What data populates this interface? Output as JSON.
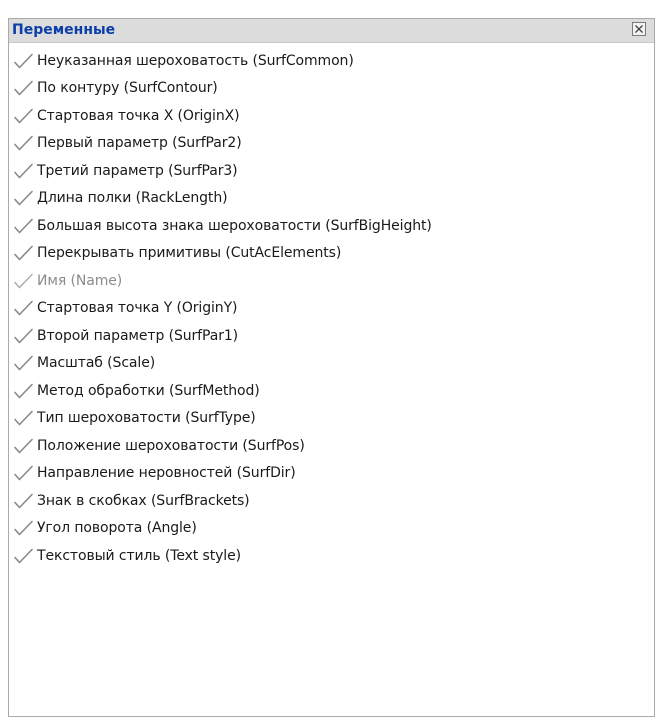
{
  "panel": {
    "title": "Переменные",
    "close_icon": "close-x-icon"
  },
  "items": [
    {
      "label": "Неуказанная шероховатость (SurfCommon)",
      "enabled": true
    },
    {
      "label": "По контуру (SurfContour)",
      "enabled": true
    },
    {
      "label": "Стартовая точка X (OriginX)",
      "enabled": true
    },
    {
      "label": "Первый параметр (SurfPar2)",
      "enabled": true
    },
    {
      "label": "Третий параметр (SurfPar3)",
      "enabled": true
    },
    {
      "label": "Длина полки (RackLength)",
      "enabled": true
    },
    {
      "label": "Большая высота знака шероховатости (SurfBigHeight)",
      "enabled": true
    },
    {
      "label": "Перекрывать примитивы (CutAcElements)",
      "enabled": true
    },
    {
      "label": "Имя (Name)",
      "enabled": false
    },
    {
      "label": "Стартовая точка Y (OriginY)",
      "enabled": true
    },
    {
      "label": "Второй параметр (SurfPar1)",
      "enabled": true
    },
    {
      "label": "Масштаб (Scale)",
      "enabled": true
    },
    {
      "label": "Метод обработки (SurfMethod)",
      "enabled": true
    },
    {
      "label": "Тип шероховатости (SurfType)",
      "enabled": true
    },
    {
      "label": "Положение шероховатости (SurfPos)",
      "enabled": true
    },
    {
      "label": "Направление неровностей (SurfDir)",
      "enabled": true
    },
    {
      "label": "Знак в скобках (SurfBrackets)",
      "enabled": true
    },
    {
      "label": "Угол поворота (Angle)",
      "enabled": true
    },
    {
      "label": "Текстовый стиль (Text style)",
      "enabled": true
    }
  ],
  "colors": {
    "title_text": "#0b3ea8",
    "titlebar_bg": "#dcdcdc",
    "item_text": "#1a1a1a",
    "disabled_text": "#8c8c8c",
    "check_stroke": "#8a8a8a"
  },
  "item_icon": "checkmark-icon"
}
